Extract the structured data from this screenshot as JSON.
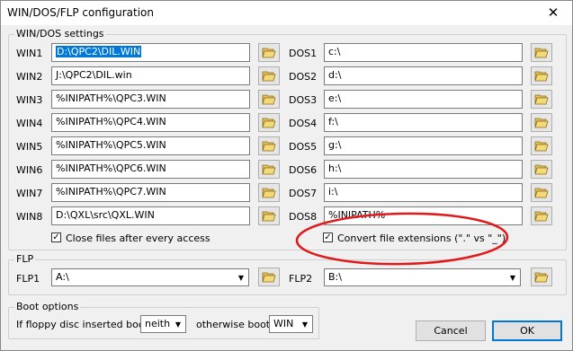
{
  "window": {
    "title": "WIN/DOS/FLP configuration",
    "close_glyph": "✕"
  },
  "windos": {
    "group_title": "WIN/DOS settings",
    "win": [
      {
        "label": "WIN1",
        "value": "D:\\QPC2\\DIL.WIN",
        "selected": true
      },
      {
        "label": "WIN2",
        "value": "J:\\QPC2\\DIL.win"
      },
      {
        "label": "WIN3",
        "value": "%INIPATH%\\QPC3.WIN"
      },
      {
        "label": "WIN4",
        "value": "%INIPATH%\\QPC4.WIN"
      },
      {
        "label": "WIN5",
        "value": "%INIPATH%\\QPC5.WIN"
      },
      {
        "label": "WIN6",
        "value": "%INIPATH%\\QPC6.WIN"
      },
      {
        "label": "WIN7",
        "value": "%INIPATH%\\QPC7.WIN"
      },
      {
        "label": "WIN8",
        "value": "D:\\QXL\\src\\QXL.WIN"
      }
    ],
    "dos": [
      {
        "label": "DOS1",
        "value": "c:\\"
      },
      {
        "label": "DOS2",
        "value": "d:\\"
      },
      {
        "label": "DOS3",
        "value": "e:\\"
      },
      {
        "label": "DOS4",
        "value": "f:\\"
      },
      {
        "label": "DOS5",
        "value": "g:\\"
      },
      {
        "label": "DOS6",
        "value": "h:\\"
      },
      {
        "label": "DOS7",
        "value": "i:\\"
      },
      {
        "label": "DOS8",
        "value": "%INIPATH%"
      }
    ],
    "close_files_label": "Close files after every access",
    "close_files_checked": true,
    "convert_ext_label": "Convert file extensions (\".\" vs \"_\")",
    "convert_ext_checked": true
  },
  "flp": {
    "group_title": "FLP",
    "flp1_label": "FLP1",
    "flp1_value": "A:\\",
    "flp2_label": "FLP2",
    "flp2_value": "B:\\"
  },
  "boot": {
    "group_title": "Boot options",
    "floppy_label": "If floppy disc inserted boot",
    "floppy_value": "neith",
    "otherwise_label": "otherwise boot",
    "otherwise_value": "WIN"
  },
  "buttons": {
    "cancel": "Cancel",
    "ok": "OK"
  },
  "icons": {
    "browse": "folder-open-icon",
    "dropdown": "chevron-down-icon"
  },
  "colors": {
    "selection": "#0078d7",
    "annotation": "#e0191b"
  }
}
